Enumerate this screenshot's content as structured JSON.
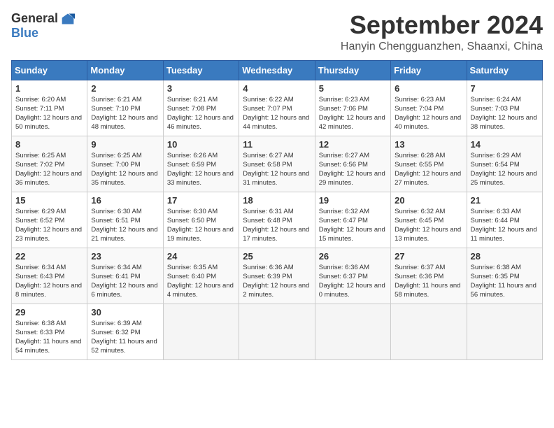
{
  "header": {
    "logo_general": "General",
    "logo_blue": "Blue",
    "month_year": "September 2024",
    "location": "Hanyin Chengguanzhen, Shaanxi, China"
  },
  "weekdays": [
    "Sunday",
    "Monday",
    "Tuesday",
    "Wednesday",
    "Thursday",
    "Friday",
    "Saturday"
  ],
  "weeks": [
    [
      {
        "day": "1",
        "sunrise": "6:20 AM",
        "sunset": "7:11 PM",
        "daylight": "12 hours and 50 minutes."
      },
      {
        "day": "2",
        "sunrise": "6:21 AM",
        "sunset": "7:10 PM",
        "daylight": "12 hours and 48 minutes."
      },
      {
        "day": "3",
        "sunrise": "6:21 AM",
        "sunset": "7:08 PM",
        "daylight": "12 hours and 46 minutes."
      },
      {
        "day": "4",
        "sunrise": "6:22 AM",
        "sunset": "7:07 PM",
        "daylight": "12 hours and 44 minutes."
      },
      {
        "day": "5",
        "sunrise": "6:23 AM",
        "sunset": "7:06 PM",
        "daylight": "12 hours and 42 minutes."
      },
      {
        "day": "6",
        "sunrise": "6:23 AM",
        "sunset": "7:04 PM",
        "daylight": "12 hours and 40 minutes."
      },
      {
        "day": "7",
        "sunrise": "6:24 AM",
        "sunset": "7:03 PM",
        "daylight": "12 hours and 38 minutes."
      }
    ],
    [
      {
        "day": "8",
        "sunrise": "6:25 AM",
        "sunset": "7:02 PM",
        "daylight": "12 hours and 36 minutes."
      },
      {
        "day": "9",
        "sunrise": "6:25 AM",
        "sunset": "7:00 PM",
        "daylight": "12 hours and 35 minutes."
      },
      {
        "day": "10",
        "sunrise": "6:26 AM",
        "sunset": "6:59 PM",
        "daylight": "12 hours and 33 minutes."
      },
      {
        "day": "11",
        "sunrise": "6:27 AM",
        "sunset": "6:58 PM",
        "daylight": "12 hours and 31 minutes."
      },
      {
        "day": "12",
        "sunrise": "6:27 AM",
        "sunset": "6:56 PM",
        "daylight": "12 hours and 29 minutes."
      },
      {
        "day": "13",
        "sunrise": "6:28 AM",
        "sunset": "6:55 PM",
        "daylight": "12 hours and 27 minutes."
      },
      {
        "day": "14",
        "sunrise": "6:29 AM",
        "sunset": "6:54 PM",
        "daylight": "12 hours and 25 minutes."
      }
    ],
    [
      {
        "day": "15",
        "sunrise": "6:29 AM",
        "sunset": "6:52 PM",
        "daylight": "12 hours and 23 minutes."
      },
      {
        "day": "16",
        "sunrise": "6:30 AM",
        "sunset": "6:51 PM",
        "daylight": "12 hours and 21 minutes."
      },
      {
        "day": "17",
        "sunrise": "6:30 AM",
        "sunset": "6:50 PM",
        "daylight": "12 hours and 19 minutes."
      },
      {
        "day": "18",
        "sunrise": "6:31 AM",
        "sunset": "6:48 PM",
        "daylight": "12 hours and 17 minutes."
      },
      {
        "day": "19",
        "sunrise": "6:32 AM",
        "sunset": "6:47 PM",
        "daylight": "12 hours and 15 minutes."
      },
      {
        "day": "20",
        "sunrise": "6:32 AM",
        "sunset": "6:45 PM",
        "daylight": "12 hours and 13 minutes."
      },
      {
        "day": "21",
        "sunrise": "6:33 AM",
        "sunset": "6:44 PM",
        "daylight": "12 hours and 11 minutes."
      }
    ],
    [
      {
        "day": "22",
        "sunrise": "6:34 AM",
        "sunset": "6:43 PM",
        "daylight": "12 hours and 8 minutes."
      },
      {
        "day": "23",
        "sunrise": "6:34 AM",
        "sunset": "6:41 PM",
        "daylight": "12 hours and 6 minutes."
      },
      {
        "day": "24",
        "sunrise": "6:35 AM",
        "sunset": "6:40 PM",
        "daylight": "12 hours and 4 minutes."
      },
      {
        "day": "25",
        "sunrise": "6:36 AM",
        "sunset": "6:39 PM",
        "daylight": "12 hours and 2 minutes."
      },
      {
        "day": "26",
        "sunrise": "6:36 AM",
        "sunset": "6:37 PM",
        "daylight": "12 hours and 0 minutes."
      },
      {
        "day": "27",
        "sunrise": "6:37 AM",
        "sunset": "6:36 PM",
        "daylight": "11 hours and 58 minutes."
      },
      {
        "day": "28",
        "sunrise": "6:38 AM",
        "sunset": "6:35 PM",
        "daylight": "11 hours and 56 minutes."
      }
    ],
    [
      {
        "day": "29",
        "sunrise": "6:38 AM",
        "sunset": "6:33 PM",
        "daylight": "11 hours and 54 minutes."
      },
      {
        "day": "30",
        "sunrise": "6:39 AM",
        "sunset": "6:32 PM",
        "daylight": "11 hours and 52 minutes."
      },
      null,
      null,
      null,
      null,
      null
    ]
  ]
}
